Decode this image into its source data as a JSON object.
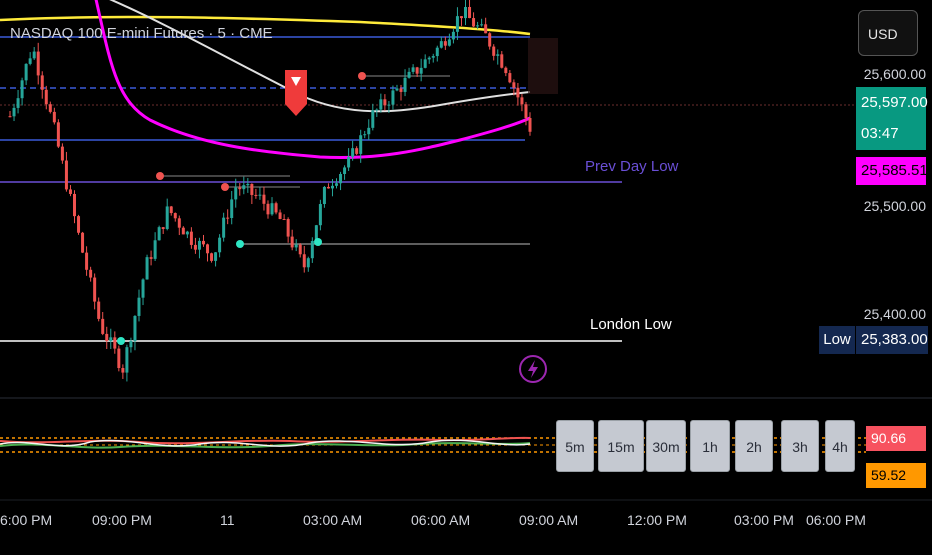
{
  "chart": {
    "symbol_title": "NASDAQ 100 E-mini Futures · 5 · CME",
    "currency": "USD"
  },
  "price_scale": {
    "labels": [
      "25,600.00",
      "25,500.00",
      "25,400.00"
    ],
    "last_price": "25,597.00",
    "countdown": "03:47",
    "vwap_value": "25,585.51",
    "low_tag": "Low",
    "low_value": "25,383.00"
  },
  "levels": {
    "prev_day_low": "Prev Day Low",
    "london_low": "London Low"
  },
  "oscillator": {
    "value_1": "90.66",
    "value_2": "59.52"
  },
  "timeframes": [
    "5m",
    "15m",
    "30m",
    "1h",
    "2h",
    "3h",
    "4h"
  ],
  "time_axis": [
    "6:00 PM",
    "09:00 PM",
    "11",
    "03:00 AM",
    "06:00 AM",
    "09:00 AM",
    "12:00 PM",
    "03:00 PM",
    "06:00 PM"
  ],
  "colors": {
    "up_candle": "#26a69a",
    "down_candle": "#ef5350",
    "vwap": "#ff00ff",
    "sma_long": "#ffeb3b",
    "sma_mid": "#e0e0e0",
    "prev_day_low": "#6a4fd6",
    "london_low": "#ffffff",
    "pivot_marker": "#2ee6c4"
  },
  "icons": {
    "sell_signal": "arrow-down-flag-icon",
    "alert": "lightning-icon"
  },
  "chart_data": {
    "type": "candlestick",
    "y_range": [
      25360,
      25700
    ],
    "levels": [
      {
        "label": "Prev Day Low",
        "value": 25562
      },
      {
        "label": "London Low",
        "value": 25383
      }
    ],
    "ohlc_close_path": [
      25600,
      25660,
      25585,
      25500,
      25420,
      25383,
      25470,
      25520,
      25495,
      25480,
      25540,
      25530,
      25510,
      25470,
      25540,
      25560,
      25600,
      25620,
      25640,
      25660,
      25690,
      25670,
      25640,
      25590
    ]
  }
}
